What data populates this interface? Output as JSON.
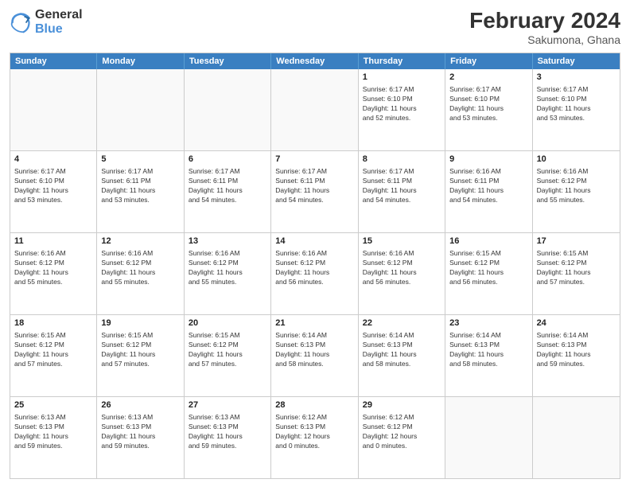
{
  "logo": {
    "line1": "General",
    "line2": "Blue"
  },
  "title": "February 2024",
  "subtitle": "Sakumona, Ghana",
  "header_days": [
    "Sunday",
    "Monday",
    "Tuesday",
    "Wednesday",
    "Thursday",
    "Friday",
    "Saturday"
  ],
  "weeks": [
    [
      {
        "day": "",
        "info": ""
      },
      {
        "day": "",
        "info": ""
      },
      {
        "day": "",
        "info": ""
      },
      {
        "day": "",
        "info": ""
      },
      {
        "day": "1",
        "info": "Sunrise: 6:17 AM\nSunset: 6:10 PM\nDaylight: 11 hours\nand 52 minutes."
      },
      {
        "day": "2",
        "info": "Sunrise: 6:17 AM\nSunset: 6:10 PM\nDaylight: 11 hours\nand 53 minutes."
      },
      {
        "day": "3",
        "info": "Sunrise: 6:17 AM\nSunset: 6:10 PM\nDaylight: 11 hours\nand 53 minutes."
      }
    ],
    [
      {
        "day": "4",
        "info": "Sunrise: 6:17 AM\nSunset: 6:10 PM\nDaylight: 11 hours\nand 53 minutes."
      },
      {
        "day": "5",
        "info": "Sunrise: 6:17 AM\nSunset: 6:11 PM\nDaylight: 11 hours\nand 53 minutes."
      },
      {
        "day": "6",
        "info": "Sunrise: 6:17 AM\nSunset: 6:11 PM\nDaylight: 11 hours\nand 54 minutes."
      },
      {
        "day": "7",
        "info": "Sunrise: 6:17 AM\nSunset: 6:11 PM\nDaylight: 11 hours\nand 54 minutes."
      },
      {
        "day": "8",
        "info": "Sunrise: 6:17 AM\nSunset: 6:11 PM\nDaylight: 11 hours\nand 54 minutes."
      },
      {
        "day": "9",
        "info": "Sunrise: 6:16 AM\nSunset: 6:11 PM\nDaylight: 11 hours\nand 54 minutes."
      },
      {
        "day": "10",
        "info": "Sunrise: 6:16 AM\nSunset: 6:12 PM\nDaylight: 11 hours\nand 55 minutes."
      }
    ],
    [
      {
        "day": "11",
        "info": "Sunrise: 6:16 AM\nSunset: 6:12 PM\nDaylight: 11 hours\nand 55 minutes."
      },
      {
        "day": "12",
        "info": "Sunrise: 6:16 AM\nSunset: 6:12 PM\nDaylight: 11 hours\nand 55 minutes."
      },
      {
        "day": "13",
        "info": "Sunrise: 6:16 AM\nSunset: 6:12 PM\nDaylight: 11 hours\nand 55 minutes."
      },
      {
        "day": "14",
        "info": "Sunrise: 6:16 AM\nSunset: 6:12 PM\nDaylight: 11 hours\nand 56 minutes."
      },
      {
        "day": "15",
        "info": "Sunrise: 6:16 AM\nSunset: 6:12 PM\nDaylight: 11 hours\nand 56 minutes."
      },
      {
        "day": "16",
        "info": "Sunrise: 6:15 AM\nSunset: 6:12 PM\nDaylight: 11 hours\nand 56 minutes."
      },
      {
        "day": "17",
        "info": "Sunrise: 6:15 AM\nSunset: 6:12 PM\nDaylight: 11 hours\nand 57 minutes."
      }
    ],
    [
      {
        "day": "18",
        "info": "Sunrise: 6:15 AM\nSunset: 6:12 PM\nDaylight: 11 hours\nand 57 minutes."
      },
      {
        "day": "19",
        "info": "Sunrise: 6:15 AM\nSunset: 6:12 PM\nDaylight: 11 hours\nand 57 minutes."
      },
      {
        "day": "20",
        "info": "Sunrise: 6:15 AM\nSunset: 6:12 PM\nDaylight: 11 hours\nand 57 minutes."
      },
      {
        "day": "21",
        "info": "Sunrise: 6:14 AM\nSunset: 6:13 PM\nDaylight: 11 hours\nand 58 minutes."
      },
      {
        "day": "22",
        "info": "Sunrise: 6:14 AM\nSunset: 6:13 PM\nDaylight: 11 hours\nand 58 minutes."
      },
      {
        "day": "23",
        "info": "Sunrise: 6:14 AM\nSunset: 6:13 PM\nDaylight: 11 hours\nand 58 minutes."
      },
      {
        "day": "24",
        "info": "Sunrise: 6:14 AM\nSunset: 6:13 PM\nDaylight: 11 hours\nand 59 minutes."
      }
    ],
    [
      {
        "day": "25",
        "info": "Sunrise: 6:13 AM\nSunset: 6:13 PM\nDaylight: 11 hours\nand 59 minutes."
      },
      {
        "day": "26",
        "info": "Sunrise: 6:13 AM\nSunset: 6:13 PM\nDaylight: 11 hours\nand 59 minutes."
      },
      {
        "day": "27",
        "info": "Sunrise: 6:13 AM\nSunset: 6:13 PM\nDaylight: 11 hours\nand 59 minutes."
      },
      {
        "day": "28",
        "info": "Sunrise: 6:12 AM\nSunset: 6:13 PM\nDaylight: 12 hours\nand 0 minutes."
      },
      {
        "day": "29",
        "info": "Sunrise: 6:12 AM\nSunset: 6:12 PM\nDaylight: 12 hours\nand 0 minutes."
      },
      {
        "day": "",
        "info": ""
      },
      {
        "day": "",
        "info": ""
      }
    ]
  ]
}
